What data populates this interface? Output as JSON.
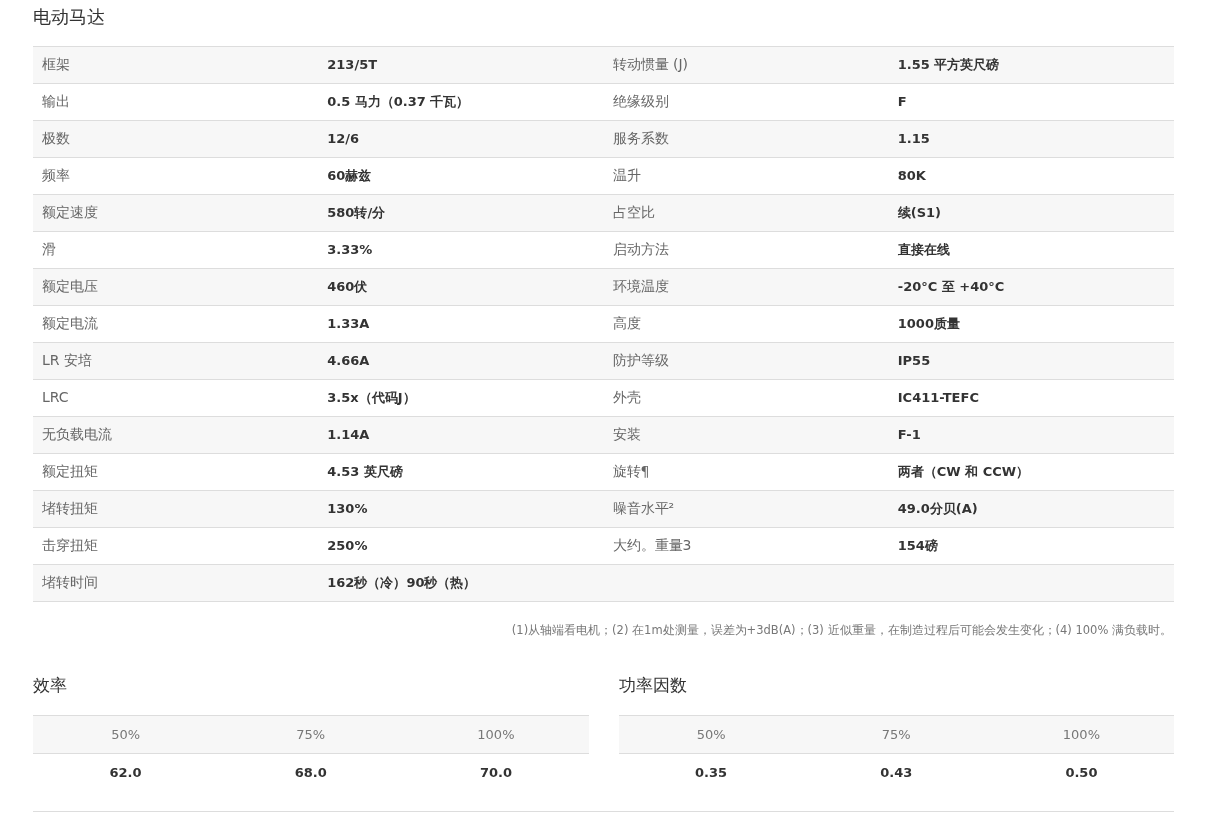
{
  "title": "电动马达",
  "specs": [
    {
      "cells": [
        {
          "label": "框架",
          "value": "213/5T"
        },
        {
          "label": "转动惯量 (J)",
          "value": "1.55 平方英尺磅"
        }
      ]
    },
    {
      "cells": [
        {
          "label": "输出",
          "value": "0.5 马力（0.37 千瓦）"
        },
        {
          "label": "绝缘级别",
          "value": "F"
        }
      ]
    },
    {
      "cells": [
        {
          "label": "极数",
          "value": "12/6"
        },
        {
          "label": "服务系数",
          "value": "1.15"
        }
      ]
    },
    {
      "cells": [
        {
          "label": "频率",
          "value": "60赫兹"
        },
        {
          "label": "温升",
          "value": "80K"
        }
      ]
    },
    {
      "cells": [
        {
          "label": "额定速度",
          "value": "580转/分"
        },
        {
          "label": "占空比",
          "value": "续(S1)"
        }
      ]
    },
    {
      "cells": [
        {
          "label": "滑",
          "value": "3.33%"
        },
        {
          "label": "启动方法",
          "value": "直接在线"
        }
      ]
    },
    {
      "cells": [
        {
          "label": "额定电压",
          "value": "460伏"
        },
        {
          "label": "环境温度",
          "value": "-20°C 至 +40°C"
        }
      ]
    },
    {
      "cells": [
        {
          "label": "额定电流",
          "value": "1.33A"
        },
        {
          "label": "高度",
          "value": "1000质量"
        }
      ]
    },
    {
      "cells": [
        {
          "label": "LR 安培",
          "value": "4.66A"
        },
        {
          "label": "防护等级",
          "value": "IP55"
        }
      ]
    },
    {
      "cells": [
        {
          "label": "LRC",
          "value": "3.5x（代码J）"
        },
        {
          "label": "外壳",
          "value": "IC411-TEFC"
        }
      ]
    },
    {
      "cells": [
        {
          "label": "无负载电流",
          "value": "1.14A"
        },
        {
          "label": "安装",
          "value": "F-1"
        }
      ]
    },
    {
      "cells": [
        {
          "label": "额定扭矩",
          "value": "4.53 英尺磅"
        },
        {
          "label": "旋转¶",
          "value": "两者（CW 和 CCW）"
        }
      ]
    },
    {
      "cells": [
        {
          "label": "堵转扭矩",
          "value": "130%"
        },
        {
          "label": "噪音水平²",
          "value": "49.0分贝(A)"
        }
      ]
    },
    {
      "cells": [
        {
          "label": "击穿扭矩",
          "value": "250%"
        },
        {
          "label": "大约。重量3",
          "value": "154磅"
        }
      ]
    },
    {
      "cells": [
        {
          "label": "堵转时间",
          "value": "162秒（冷）90秒（热）"
        }
      ]
    }
  ],
  "footnote": "(1)从轴端看电机；(2) 在1m处测量，误差为+3dB(A)；(3) 近似重量，在制造过程后可能会发生变化；(4) 100% 满负载时。",
  "load_tables": [
    {
      "title": "效率",
      "columns": [
        "50%",
        "75%",
        "100%"
      ],
      "values": [
        "62.0",
        "68.0",
        "70.0"
      ]
    },
    {
      "title": "功率因数",
      "columns": [
        "50%",
        "75%",
        "100%"
      ],
      "values": [
        "0.35",
        "0.43",
        "0.50"
      ]
    }
  ]
}
